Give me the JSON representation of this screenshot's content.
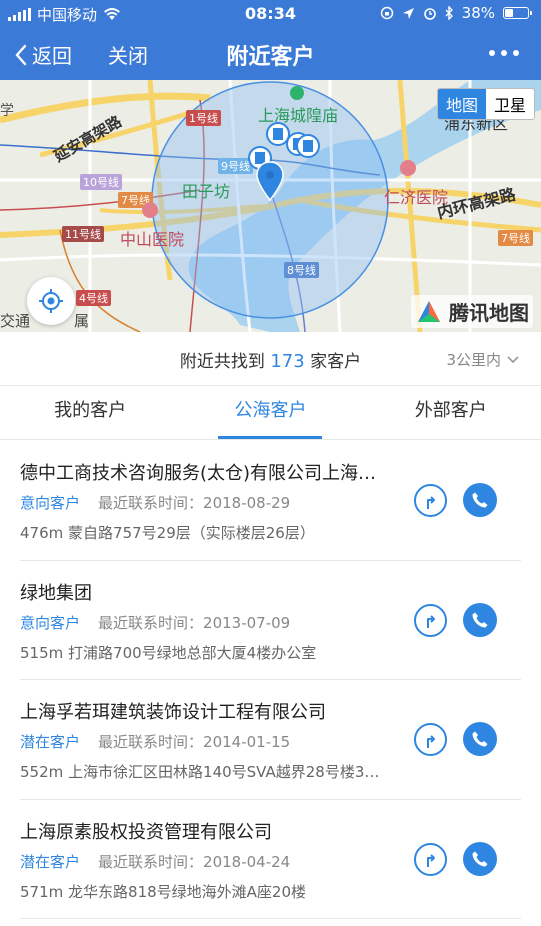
{
  "status_bar": {
    "carrier": "中国移动",
    "time": "08:34",
    "battery_percent": "38%",
    "battery_level": 0.38
  },
  "nav": {
    "back_label": "返回",
    "close_label": "关闭",
    "title": "附近客户"
  },
  "map": {
    "toggle_map": "地图",
    "toggle_satellite": "卫星",
    "brand": "腾讯地图",
    "labels": {
      "xue": "学",
      "yanan_road": "延安高架路",
      "line1": "1号线",
      "line9": "9号线",
      "line10": "10号线",
      "line7a": "7号线",
      "line11": "11号线",
      "line8": "8号线",
      "line7b": "7号线",
      "line4": "4号线",
      "chenghuang": "上海城隍庙",
      "tianzifang": "田子坊",
      "zhongshan_hospital": "中山医院",
      "renji_hospital": "仁济医院",
      "inner_ring": "内环高架路",
      "pudong": "浦东新区",
      "traffic": "交通",
      "shu": "属"
    }
  },
  "summary": {
    "prefix": "附近共找到",
    "count": "173",
    "suffix": "家客户",
    "range": "3公里内"
  },
  "tabs": [
    {
      "label": "我的客户"
    },
    {
      "label": "公海客户"
    },
    {
      "label": "外部客户"
    }
  ],
  "customers": [
    {
      "name": "德中工商技术咨询服务(太仓)有限公司上海…",
      "tag": "意向客户",
      "contact_label": "最近联系时间：",
      "contact_date": "2018-08-29",
      "distance": "476m",
      "address": "蒙自路757号29层（实际楼层26层）"
    },
    {
      "name": "绿地集团",
      "tag": "意向客户",
      "contact_label": "最近联系时间：",
      "contact_date": "2013-07-09",
      "distance": "515m",
      "address": "打浦路700号绿地总部大厦4楼办公室"
    },
    {
      "name": "上海孚若珥建筑装饰设计工程有限公司",
      "tag": "潜在客户",
      "contact_label": "最近联系时间：",
      "contact_date": "2014-01-15",
      "distance": "552m",
      "address": "上海市徐汇区田林路140号SVA越界28号楼3…"
    },
    {
      "name": "上海原素股权投资管理有限公司",
      "tag": "潜在客户",
      "contact_label": "最近联系时间：",
      "contact_date": "2018-04-24",
      "distance": "571m",
      "address": "龙华东路818号绿地海外滩A座20楼"
    }
  ],
  "colors": {
    "primary": "#2f86e0",
    "header": "#3b7ad6"
  }
}
